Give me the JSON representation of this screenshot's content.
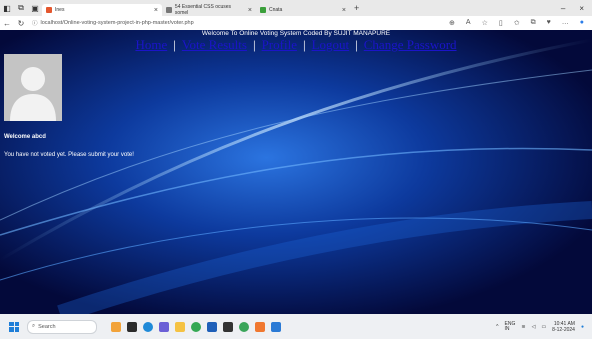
{
  "browser": {
    "tabs": [
      {
        "label": "Ines",
        "color": "#e4572e",
        "active": true
      },
      {
        "label": "54 Essential CSS ocuses somel",
        "color": "#777777",
        "active": false
      },
      {
        "label": "Cnata",
        "color": "#3a9f3a",
        "active": false
      }
    ],
    "url": "localhost/Online-voting-system-project-in-php-master/voter.php"
  },
  "page": {
    "welcome_banner": "Welcome To Online Voting System Coded By SUJIT MANAPURE",
    "nav": {
      "home": "Home",
      "vote_results": "Vote Results",
      "profile": "Profile",
      "logout": "Logout",
      "change_password": "Change Password",
      "separator": "|"
    },
    "welcome_user": "Welcome abcd",
    "vote_message": "You have not voted yet. Please submit your vote!"
  },
  "taskbar": {
    "search_label": "Search",
    "lang": "ENG\nIN",
    "time": "10:41 AM",
    "date": "8-12-2024"
  },
  "colors": {
    "link": "#1b14c9",
    "page_bg": "#06154d"
  }
}
